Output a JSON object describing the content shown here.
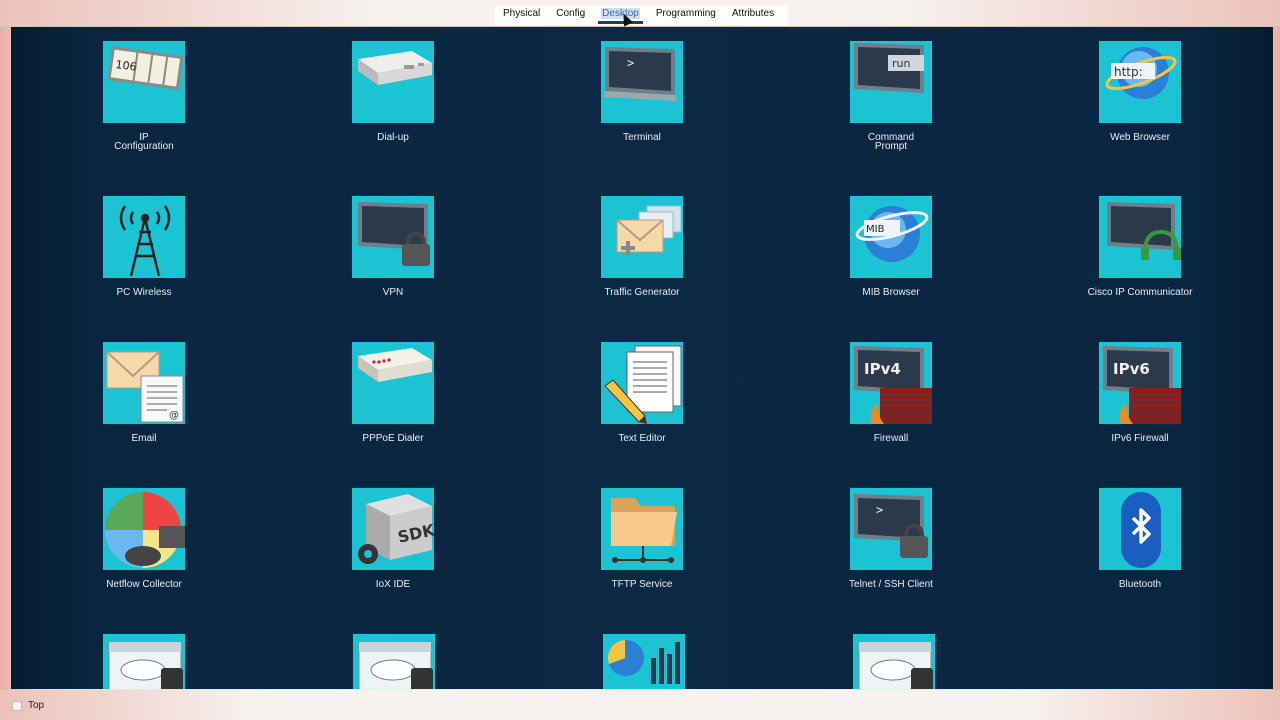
{
  "tabs": [
    "Physical",
    "Config",
    "Desktop",
    "Programming",
    "Attributes"
  ],
  "active_tab": "Desktop",
  "apps": [
    {
      "label": "IP\nConfiguration",
      "icon": "ip-configuration-icon"
    },
    {
      "label": "Dial-up",
      "icon": "modem-icon"
    },
    {
      "label": "Terminal",
      "icon": "terminal-icon"
    },
    {
      "label": "Command\nPrompt",
      "icon": "command-prompt-icon"
    },
    {
      "label": "Web Browser",
      "icon": "web-browser-icon"
    },
    {
      "label": "PC Wireless",
      "icon": "wireless-tower-icon"
    },
    {
      "label": "VPN",
      "icon": "vpn-lock-icon"
    },
    {
      "label": "Traffic Generator",
      "icon": "traffic-generator-icon"
    },
    {
      "label": "MIB Browser",
      "icon": "mib-globe-icon"
    },
    {
      "label": "Cisco IP Communicator",
      "icon": "ip-communicator-headset-icon"
    },
    {
      "label": "Email",
      "icon": "email-icon"
    },
    {
      "label": "PPPoE Dialer",
      "icon": "pppoe-modem-icon"
    },
    {
      "label": "Text Editor",
      "icon": "text-editor-icon"
    },
    {
      "label": "Firewall",
      "icon": "ipv4-firewall-icon"
    },
    {
      "label": "IPv6 Firewall",
      "icon": "ipv6-firewall-icon"
    },
    {
      "label": "Netflow Collector",
      "icon": "netflow-collector-icon"
    },
    {
      "label": "IoX IDE",
      "icon": "iox-sdk-icon"
    },
    {
      "label": "TFTP Service",
      "icon": "tftp-folder-icon"
    },
    {
      "label": "Telnet / SSH Client",
      "icon": "telnet-ssh-icon"
    },
    {
      "label": "Bluetooth",
      "icon": "bluetooth-icon"
    },
    {
      "label": "",
      "icon": "cloud-app-icon"
    },
    {
      "label": "",
      "icon": "cloud-app-icon"
    },
    {
      "label": "",
      "icon": "dashboard-chart-icon"
    },
    {
      "label": "",
      "icon": "cloud-app-icon"
    }
  ],
  "icon_text": {
    "ip": "106",
    "cmd": "run",
    "web": "http:",
    "mib": "MIB",
    "ipv4": "IPv4",
    "ipv6": "IPv6",
    "sdk": "SDK",
    "prompt": ">"
  },
  "footer": {
    "top_label": "Top"
  },
  "colors": {
    "desktop_bg": "#0b2844",
    "tile_bg": "#1cc3d2",
    "label": "#e8eef3",
    "accent": "#2d6fb3"
  }
}
